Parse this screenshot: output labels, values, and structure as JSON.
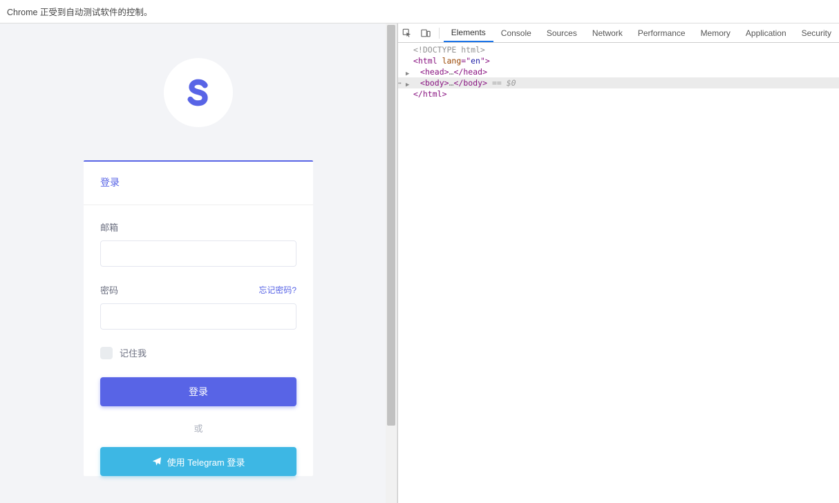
{
  "automation_bar": "Chrome 正受到自动测试软件的控制。",
  "login": {
    "title": "登录",
    "email_label": "邮箱",
    "email_value": "",
    "password_label": "密码",
    "password_value": "",
    "forgot": "忘记密码?",
    "remember": "记住我",
    "submit": "登录",
    "or": "或",
    "telegram": "使用 Telegram 登录"
  },
  "devtools": {
    "tabs": [
      "Elements",
      "Console",
      "Sources",
      "Network",
      "Performance",
      "Memory",
      "Application",
      "Security"
    ],
    "active_tab": "Elements",
    "dom": {
      "line0": "<!DOCTYPE html>",
      "html_open_prefix": "<html ",
      "html_attr_name": "lang",
      "html_attr_eq": "=\"",
      "html_attr_val": "en",
      "html_attr_close": "\">",
      "head_open": "<head>",
      "head_ellipsis": "…",
      "head_close": "</head>",
      "body_open": "<body>",
      "body_ellipsis": "…",
      "body_close": "</body>",
      "selected_marker": " == $0",
      "html_close": "</html>"
    }
  }
}
